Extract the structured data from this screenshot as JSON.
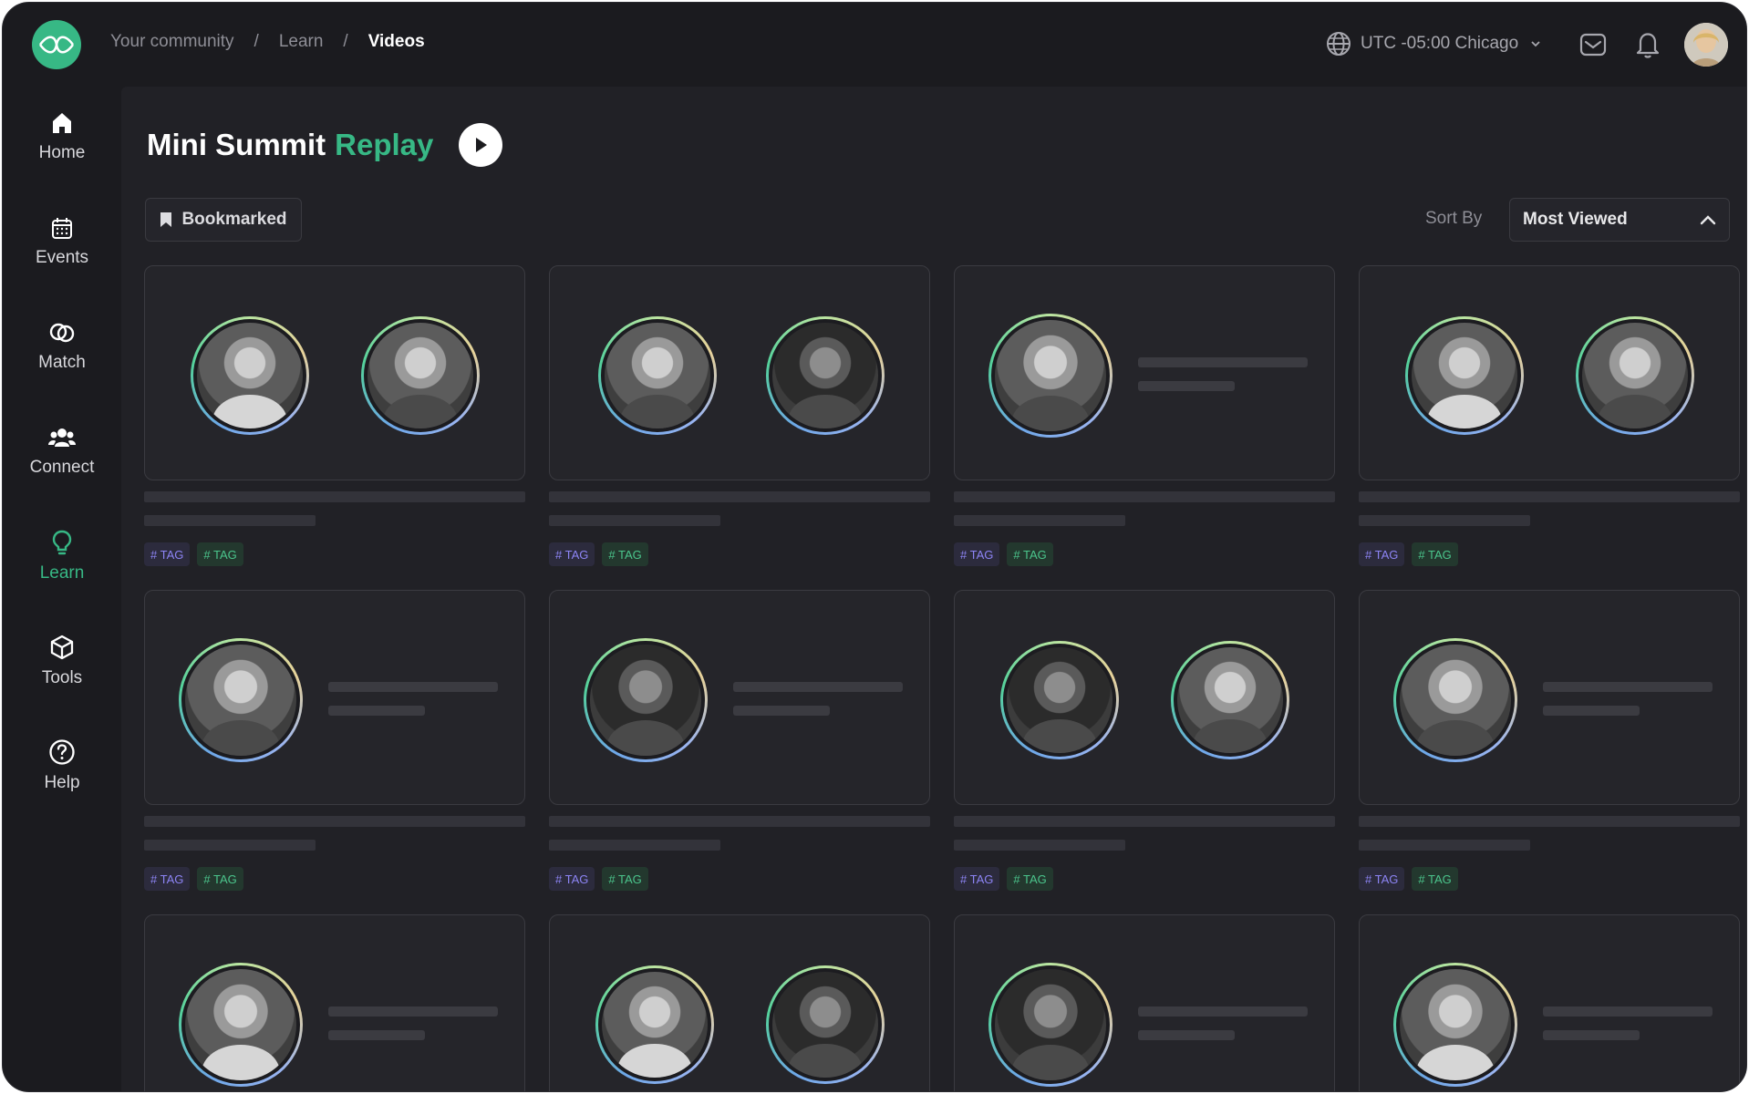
{
  "breadcrumb": [
    "Your community",
    "Learn",
    "Videos"
  ],
  "timezone": "UTC -05:00 Chicago",
  "sidebar": {
    "items": [
      {
        "label": "Home",
        "icon": "home-icon"
      },
      {
        "label": "Events",
        "icon": "calendar-icon"
      },
      {
        "label": "Match",
        "icon": "match-icon"
      },
      {
        "label": "Connect",
        "icon": "people-icon"
      },
      {
        "label": "Learn",
        "icon": "lightbulb-icon",
        "active": true
      },
      {
        "label": "Tools",
        "icon": "box-icon"
      },
      {
        "label": "Help",
        "icon": "help-icon"
      }
    ]
  },
  "page": {
    "title": "Mini Summit",
    "title_accent": "Replay"
  },
  "filters": {
    "bookmarked_label": "Bookmarked",
    "sort_by_label": "Sort By",
    "sort_value": "Most Viewed"
  },
  "tags": {
    "tag1": "# TAG",
    "tag2": "# TAG"
  },
  "colors": {
    "accent": "#37b885",
    "background": "#1b1b1f",
    "panel": "#212126",
    "tag_purple": "#8d84f5",
    "tag_green": "#4bc58c"
  },
  "videos": [
    {
      "speakers": 2
    },
    {
      "speakers": 2
    },
    {
      "speakers": 1
    },
    {
      "speakers": 2
    },
    {
      "speakers": 1
    },
    {
      "speakers": 1
    },
    {
      "speakers": 2
    },
    {
      "speakers": 1
    },
    {
      "speakers": 1
    },
    {
      "speakers": 2
    },
    {
      "speakers": 1
    },
    {
      "speakers": 1
    }
  ]
}
